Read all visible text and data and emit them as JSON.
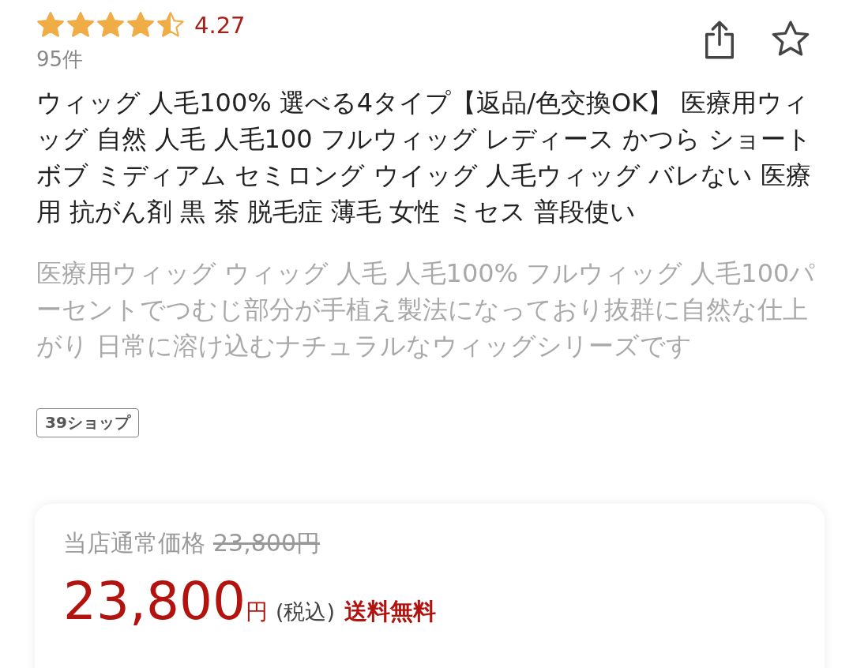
{
  "rating": {
    "stars": 4.5,
    "score": "4.27",
    "count": "95件"
  },
  "title": "ウィッグ 人毛100% 選べる4タイプ【返品/色交換OK】 医療用ウィッグ 自然 人毛 人毛100 フルウィッグ レディース かつら ショートボブ ミディアム セミロング ウイッグ 人毛ウィッグ バレない 医療用 抗がん剤 黒 茶 脱毛症 薄毛 女性 ミセス 普段使い",
  "description": "医療用ウィッグ ウィッグ 人毛 人毛100% フルウィッグ 人毛100パーセントでつむじ部分が手植え製法になっており抜群に自然な仕上がり 日常に溶け込むナチュラルなウィッグシリーズです",
  "tags": [
    "39ショップ"
  ],
  "price": {
    "regular_label": "当店通常価格",
    "regular_price": "23,800円",
    "price": "23,800",
    "unit": "円",
    "tax": "(税込)",
    "shipping": "送料無料"
  }
}
